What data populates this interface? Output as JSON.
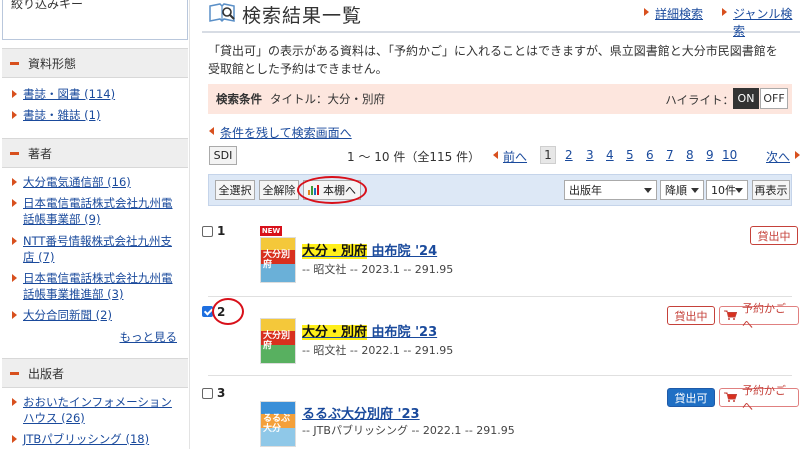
{
  "sidebar": {
    "keyword_label": "絞り込みキー",
    "sections": [
      {
        "title": "資料形態",
        "items": [
          "書誌・図書 (114)",
          "書誌・雑誌 (1)"
        ]
      },
      {
        "title": "著者",
        "items": [
          "大分電気通信部 (16)",
          "日本電信電話株式会社九州電話帳事業部 (9)",
          "NTT番号情報株式会社九州支店 (7)",
          "日本電信電話株式会社九州電話帳事業推進部 (3)",
          "大分合同新聞 (2)"
        ],
        "more": "もっと見る"
      },
      {
        "title": "出版者",
        "items": [
          "おおいたインフォメーションハウス (26)",
          "JTBパブリッシング (18)"
        ]
      }
    ]
  },
  "header": {
    "title": "検索結果一覧",
    "links": {
      "advanced": "詳細検索",
      "genre": "ジャンル検索"
    }
  },
  "notice": "「貸出可」の表示がある資料は、「予約かご」に入れることはできますが、県立図書館と大分市民図書館を受取館とした予約はできません。",
  "condition": {
    "label": "検索条件",
    "value": "タイトル：大分・別府",
    "highlight_label": "ハイライト：",
    "on": "ON",
    "off": "OFF"
  },
  "back_link": "条件を残して検索画面へ",
  "pagination": {
    "sdi": "SDI",
    "range": "1 〜 10 件（全115 件）",
    "prev": "前へ",
    "current": "1",
    "pages": [
      "2",
      "3",
      "4",
      "5",
      "6",
      "7",
      "8",
      "9",
      "10"
    ],
    "next": "次へ"
  },
  "toolbar": {
    "select_all": "全選択",
    "deselect_all": "全解除",
    "shelf": "本棚へ",
    "sort_field": "出版年",
    "sort_order": "降順",
    "per_page": "10件",
    "redisplay": "再表示"
  },
  "results": [
    {
      "num": "1",
      "checked": false,
      "new_badge": "NEW",
      "cover_text": "大分別府",
      "title_hl": "大分・別府",
      "title_rest": " 由布院 '24",
      "meta": "-- 昭文社 -- 2023.1 -- 291.95",
      "status": "貸出中",
      "cart": ""
    },
    {
      "num": "2",
      "checked": true,
      "new_badge": "",
      "cover_text": "大分別府",
      "title_hl": "大分・別府",
      "title_rest": " 由布院 '23",
      "meta": "-- 昭文社 -- 2022.1 -- 291.95",
      "status": "貸出中",
      "cart": "予約かごへ"
    },
    {
      "num": "3",
      "checked": false,
      "new_badge": "",
      "cover_text": "るるぶ大分",
      "title_hl": "",
      "title_rest": "るるぶ大分別府 '23",
      "meta": "-- JTBパブリッシング -- 2022.1 -- 291.95",
      "status": "貸出可",
      "cart": "予約かごへ"
    }
  ],
  "colors": {
    "accent_orange": "#d8501e",
    "link_blue": "#1a4a9c",
    "highlight_yellow": "#ffef1a",
    "condition_bg": "#fde6de",
    "toolbar_bg": "#dde8f6",
    "annotation_red": "#d8101a"
  },
  "icons": [
    "search-result-icon",
    "shelf-chart-icon",
    "cart-icon"
  ]
}
